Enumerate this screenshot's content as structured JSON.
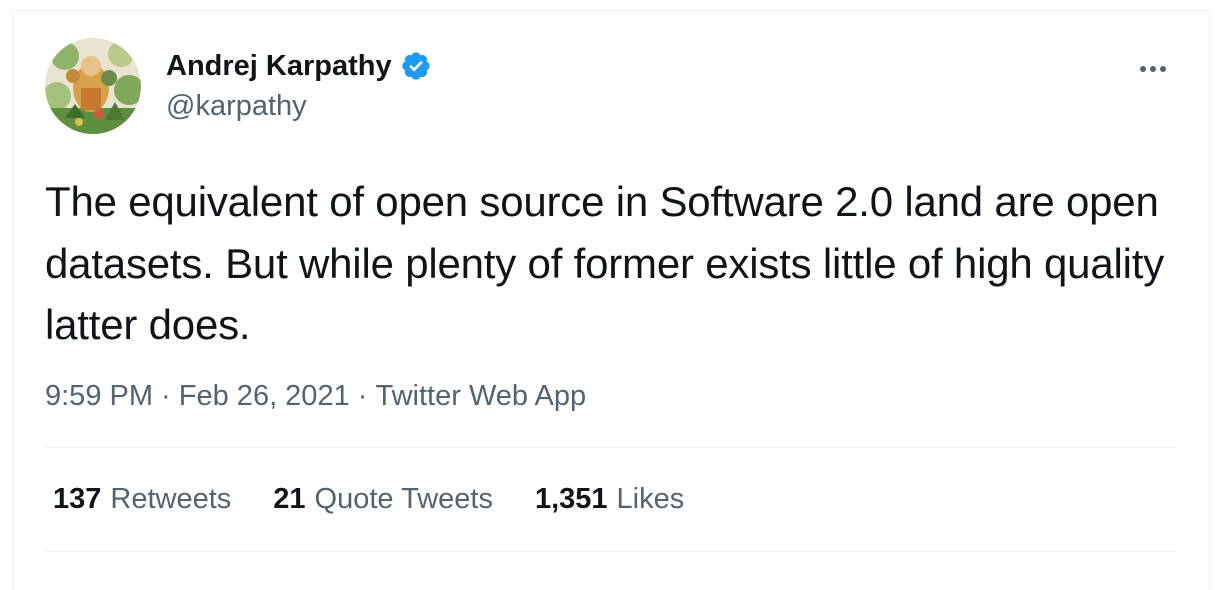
{
  "author": {
    "display_name": "Andrej Karpathy",
    "handle": "@karpathy",
    "verified": true,
    "avatar_icon": "avatar-illustration",
    "verified_color": "#1d9bf0"
  },
  "tweet": {
    "text": "The equivalent of open source in Software 2.0 land are open datasets. But while plenty of former exists little of high quality latter does.",
    "time": "9:59 PM",
    "separator": " · ",
    "date": "Feb 26, 2021",
    "source": "Twitter Web App"
  },
  "stats": {
    "retweets": {
      "count": "137",
      "label": "Retweets"
    },
    "quote_tweets": {
      "count": "21",
      "label": "Quote Tweets"
    },
    "likes": {
      "count": "1,351",
      "label": "Likes"
    }
  },
  "colors": {
    "primary_text": "#0f1419",
    "secondary_text": "#536471",
    "divider": "#eff3f4"
  }
}
